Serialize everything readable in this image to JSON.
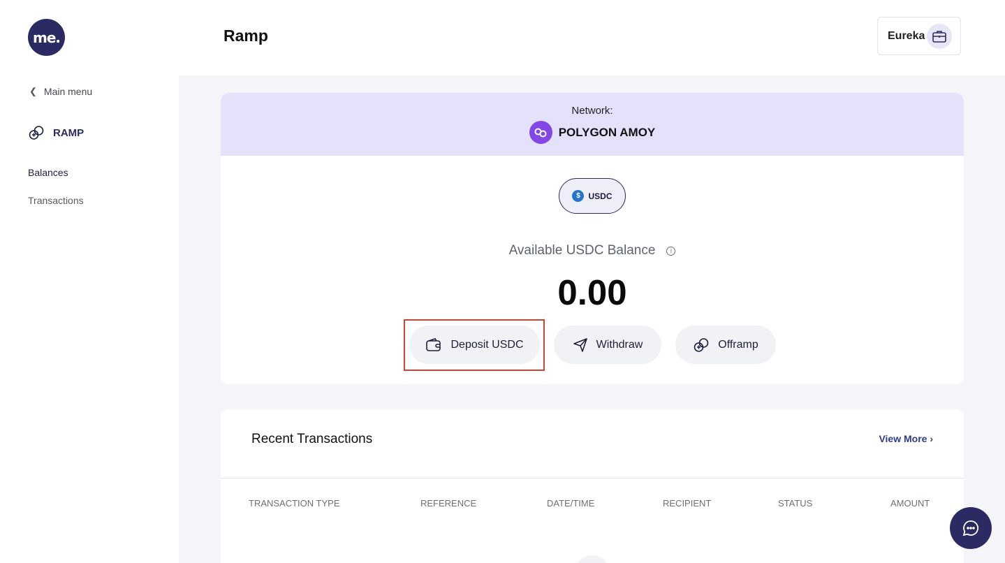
{
  "brand": {
    "logo_text": "me.",
    "accent": "#2b2a63",
    "network_color": "#8247e5",
    "highlight_color": "#d9412f"
  },
  "sidebar": {
    "back_label": "Main menu",
    "section_title": "RAMP",
    "items": [
      {
        "label": "Balances",
        "active": true
      },
      {
        "label": "Transactions",
        "active": false
      }
    ]
  },
  "header": {
    "title": "Ramp",
    "account_name": "Eureka",
    "account_icon": "briefcase-icon"
  },
  "network": {
    "label": "Network:",
    "name": "POLYGON AMOY"
  },
  "asset": {
    "chip_label": "USDC",
    "coin_symbol": "$"
  },
  "balance": {
    "label": "Available USDC Balance",
    "value": "0.00"
  },
  "actions": {
    "deposit": "Deposit USDC",
    "withdraw": "Withdraw",
    "offramp": "Offramp"
  },
  "transactions": {
    "title": "Recent Transactions",
    "view_more": "View More",
    "columns": [
      "TRANSACTION TYPE",
      "REFERENCE",
      "DATE/TIME",
      "RECIPIENT",
      "STATUS",
      "AMOUNT"
    ]
  }
}
